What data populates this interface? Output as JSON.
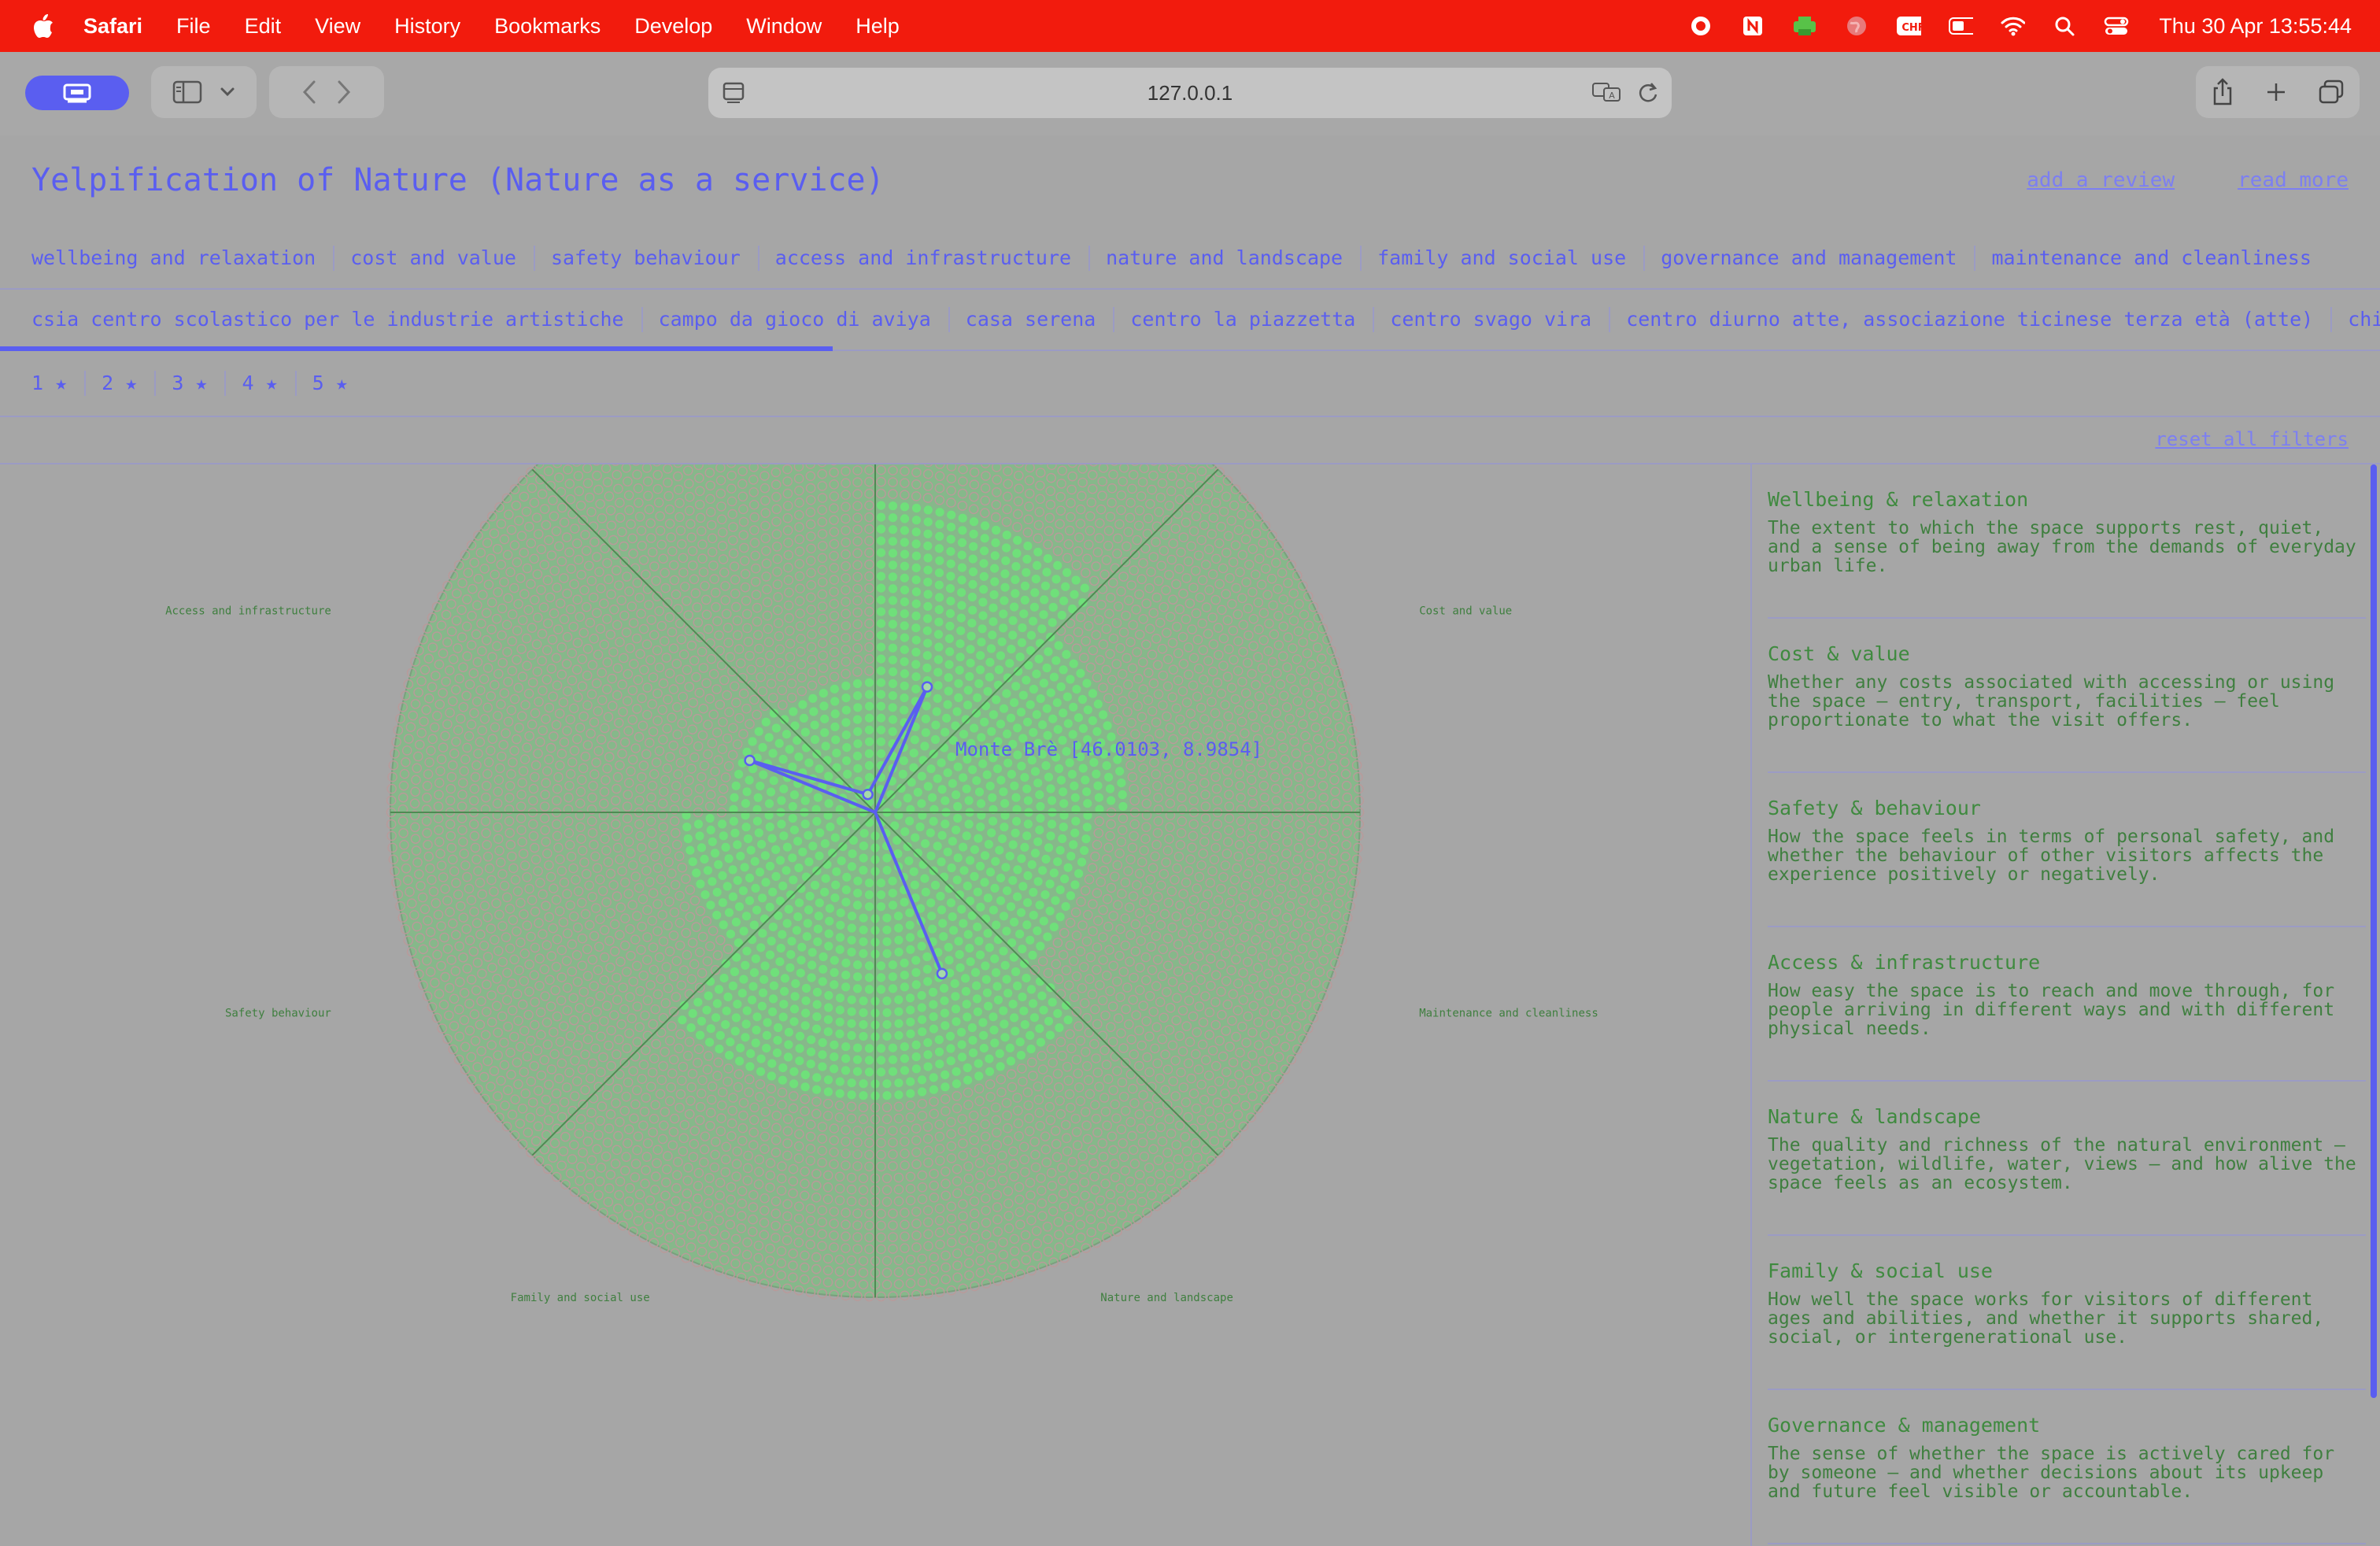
{
  "menubar": {
    "app": "Safari",
    "items": [
      "File",
      "Edit",
      "View",
      "History",
      "Bookmarks",
      "Develop",
      "Window",
      "Help"
    ],
    "clock": "Thu 30 Apr  13:55:44",
    "icons": [
      "record-icon",
      "notion-icon",
      "printer-icon",
      "globe-icon",
      "chf-icon",
      "battery-icon",
      "wifi-icon",
      "search-icon",
      "control-center-icon"
    ]
  },
  "browser": {
    "url": "127.0.0.1"
  },
  "page": {
    "title": "Yelpification of Nature (Nature as a service)",
    "links": [
      "add a review",
      "read more"
    ],
    "categories": [
      "wellbeing and relaxation",
      "cost and value",
      "safety behaviour",
      "access and infrastructure",
      "nature and landscape",
      "family and social use",
      "governance and management",
      "maintenance and cleanliness"
    ],
    "places": [
      "csia centro scolastico per le industrie artistiche",
      "campo da gioco di aviya",
      "casa serena",
      "centro la piazzetta",
      "centro svago vira",
      "centro diurno atte, associazione ticinese terza età (atte)",
      "chiesa santa"
    ],
    "places_scroll_progress": 0.35,
    "stars": [
      "1 ★",
      "2 ★",
      "3 ★",
      "4 ★",
      "5 ★"
    ],
    "reset": "reset all filters"
  },
  "chart_data": {
    "type": "radar",
    "axes": [
      "Wellbeing and relaxation",
      "Cost and value",
      "Maintenance and cleanliness",
      "Nature and landscape",
      "Family and social use",
      "Safety behaviour",
      "Access and infrastructure",
      "Governance and management"
    ],
    "range": [
      0,
      5
    ],
    "sector_scores": [
      3.2,
      2.6,
      2.2,
      3.0,
      3.0,
      2.0,
      1.5,
      1.4
    ],
    "highlight": {
      "label": "Monte Brè [46.0103, 8.9854]",
      "values": [
        1.4,
        0.0,
        0.0,
        1.8,
        0.0,
        0.0,
        1.4,
        0.2
      ]
    },
    "colors": {
      "grid_dot": "#b99a9a",
      "score_dot": "#6fe07a",
      "disc": "#86b88a",
      "line": "#5a5ef0",
      "label": "#3f7f3f"
    }
  },
  "definitions": [
    {
      "title": "Wellbeing & relaxation",
      "text": "The extent to which the space supports rest, quiet, and a sense of being away from the demands of everyday urban life."
    },
    {
      "title": "Cost & value",
      "text": "Whether any costs associated with accessing or using the space — entry, transport, facilities — feel proportionate to what the visit offers."
    },
    {
      "title": "Safety & behaviour",
      "text": "How the space feels in terms of personal safety, and whether the behaviour of other visitors affects the experience positively or negatively."
    },
    {
      "title": "Access & infrastructure",
      "text": "How easy the space is to reach and move through, for people arriving in different ways and with different physical needs."
    },
    {
      "title": "Nature & landscape",
      "text": "The quality and richness of the natural environment — vegetation, wildlife, water, views — and how alive the space feels as an ecosystem."
    },
    {
      "title": "Family & social use",
      "text": "How well the space works for visitors of different ages and abilities, and whether it supports shared, social, or intergenerational use."
    },
    {
      "title": "Governance & management",
      "text": "The sense of whether the space is actively cared for by someone — and whether decisions about its upkeep and future feel visible or accountable."
    }
  ]
}
